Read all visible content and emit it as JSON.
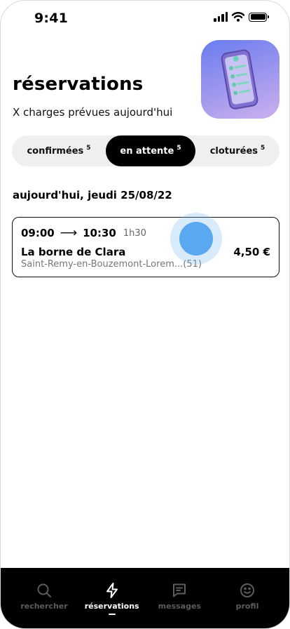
{
  "status_bar": {
    "time": "9:41",
    "icons": [
      "cellular-signal-icon",
      "wifi-icon",
      "battery-icon"
    ]
  },
  "header": {
    "title": "réservations",
    "subtitle": "X charges prévues aujourd'hui",
    "illustration": "phone-checklist-illustration"
  },
  "tabs": [
    {
      "label": "confirmées",
      "count": "5",
      "active": false
    },
    {
      "label": "en attente",
      "count": "5",
      "active": true
    },
    {
      "label": "cloturées",
      "count": "5",
      "active": false
    }
  ],
  "date_heading": "aujourd'hui, jeudi 25/08/22",
  "reservation": {
    "start_time": "09:00",
    "arrow": "⟶",
    "end_time": "10:30",
    "duration": "1h30",
    "station_name": "La borne de Clara",
    "address": "Saint-Remy-en-Bouzemont-Lorem...(51)",
    "price": "4,50 €"
  },
  "bottom_nav": [
    {
      "label": "rechercher",
      "icon": "search-icon",
      "active": false
    },
    {
      "label": "réservations",
      "icon": "lightning-icon",
      "active": true
    },
    {
      "label": "messages",
      "icon": "message-icon",
      "active": false
    },
    {
      "label": "profil",
      "icon": "smiley-icon",
      "active": false
    }
  ],
  "colors": {
    "accent_black": "#000000",
    "tab_background": "#efefef",
    "touch_indicator": "#5aa8ef",
    "hero_gradient_start": "#6a7cf0",
    "hero_gradient_end": "#cdb0ee",
    "nav_inactive": "#5c5c5c"
  }
}
